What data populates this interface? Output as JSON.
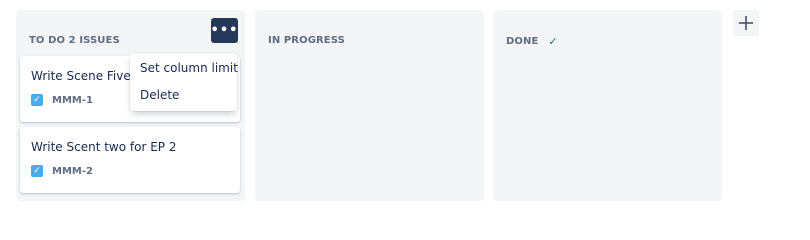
{
  "columns": [
    {
      "title": "TO DO 2 ISSUES",
      "menu_label": "•••",
      "cards": [
        {
          "title": "Write Scene Five fo",
          "key": "MMM-1"
        },
        {
          "title": "Write Scent two for EP 2",
          "key": "MMM-2"
        }
      ]
    },
    {
      "title": "IN PROGRESS",
      "cards": []
    },
    {
      "title": "DONE",
      "status_icon": "✓",
      "cards": []
    }
  ],
  "column_menu": {
    "items": [
      "Set column limit",
      "Delete"
    ]
  },
  "task_icon": "✓",
  "add_column_icon": "plus-icon",
  "colors": {
    "column_bg": "#f4f5f7",
    "menu_button": "#253858",
    "task_icon": "#4bade8",
    "done_check": "#00875a",
    "text": "#172b4d",
    "muted_text": "#5e6c84"
  }
}
